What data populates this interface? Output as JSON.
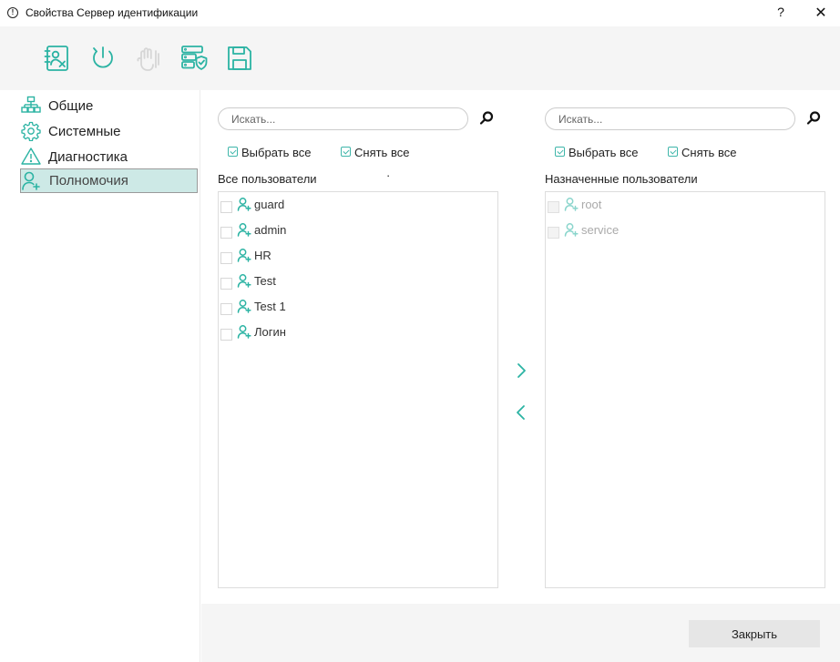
{
  "window": {
    "title": "Свойства Сервер идентификации",
    "help_label": "?",
    "close_label": "✕"
  },
  "toolbar": {
    "tools": [
      {
        "icon": "contacts-remove-icon"
      },
      {
        "icon": "power-icon"
      },
      {
        "icon": "hand-stop-icon",
        "disabled": true
      },
      {
        "icon": "server-shield-icon"
      },
      {
        "icon": "save-icon"
      }
    ]
  },
  "sidebar": {
    "items": [
      {
        "label": "Общие",
        "icon": "hierarchy-icon"
      },
      {
        "label": "Системные",
        "icon": "gear-icon"
      },
      {
        "label": "Диагностика",
        "icon": "warning-icon"
      },
      {
        "label": "Полномочия",
        "icon": "user-add-icon",
        "active": true
      }
    ]
  },
  "left_panel": {
    "search_placeholder": "Искать...",
    "select_all": "Выбрать все",
    "deselect_all": "Снять все",
    "title": "Все пользователи",
    "title_mark": "·",
    "users": [
      "guard",
      "admin",
      "HR",
      "Test",
      "Test 1",
      "Логин"
    ]
  },
  "right_panel": {
    "search_placeholder": "Искать...",
    "select_all": "Выбрать все",
    "deselect_all": "Снять все",
    "title": "Назначенные пользователи",
    "users": [
      "root",
      "service"
    ]
  },
  "footer": {
    "close_button": "Закрыть"
  },
  "colors": {
    "accent": "#2bb3a3",
    "active_bg": "#cde9e6",
    "toolbar_bg": "#f5f5f5"
  }
}
